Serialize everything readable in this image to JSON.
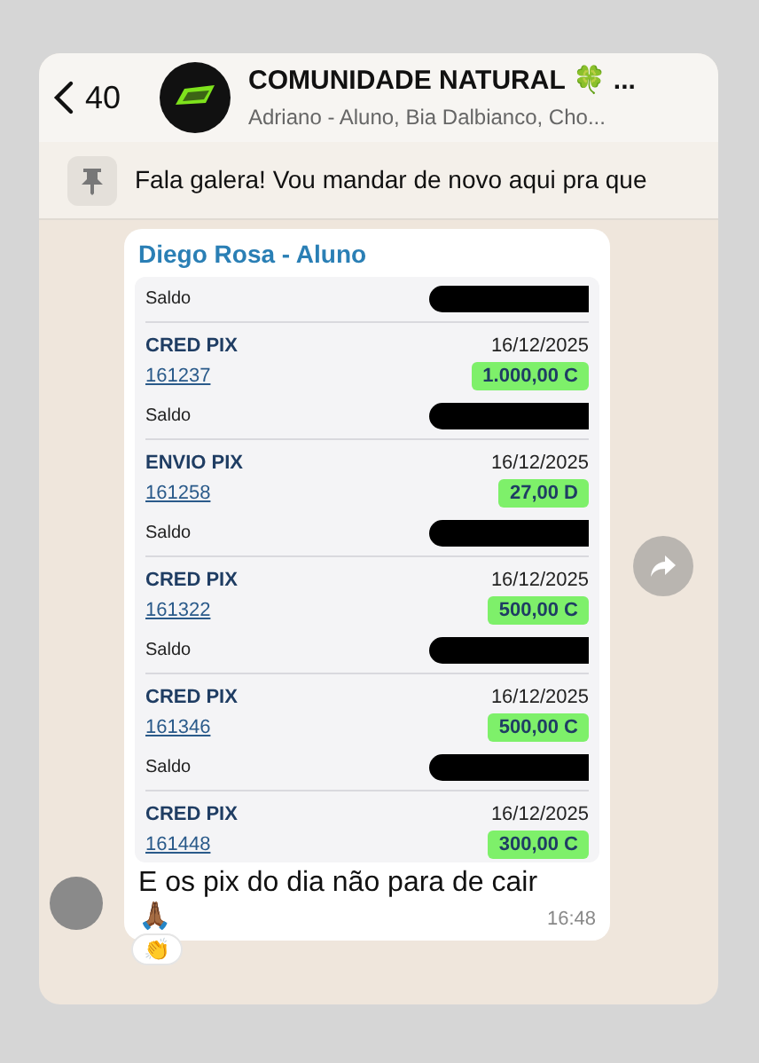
{
  "header": {
    "back_count": "40",
    "title": "COMUNIDADE NATURAL 🍀 ...",
    "subtitle": "Adriano - Aluno, Bia Dalbianco, Cho..."
  },
  "pinned": {
    "text": "Fala galera! Vou mandar de novo aqui pra que"
  },
  "message": {
    "sender": "Diego Rosa - Aluno",
    "caption": "E os pix do dia não para de cair",
    "emoji": "🙏🏾",
    "time": "16:48",
    "reaction": "👏",
    "statement": [
      {
        "kind": "balance",
        "label": "Saldo"
      },
      {
        "kind": "transaction",
        "type": "CRED PIX",
        "date": "16/12/2025",
        "doc": "161237",
        "amount": "1.000,00 C"
      },
      {
        "kind": "balance",
        "label": "Saldo"
      },
      {
        "kind": "transaction",
        "type": "ENVIO PIX",
        "date": "16/12/2025",
        "doc": "161258",
        "amount": "27,00 D"
      },
      {
        "kind": "balance",
        "label": "Saldo"
      },
      {
        "kind": "transaction",
        "type": "CRED PIX",
        "date": "16/12/2025",
        "doc": "161322",
        "amount": "500,00 C"
      },
      {
        "kind": "balance",
        "label": "Saldo"
      },
      {
        "kind": "transaction",
        "type": "CRED PIX",
        "date": "16/12/2025",
        "doc": "161346",
        "amount": "500,00 C"
      },
      {
        "kind": "balance",
        "label": "Saldo"
      },
      {
        "kind": "transaction",
        "type": "CRED PIX",
        "date": "16/12/2025",
        "doc": "161448",
        "amount": "300,00 C"
      }
    ]
  }
}
